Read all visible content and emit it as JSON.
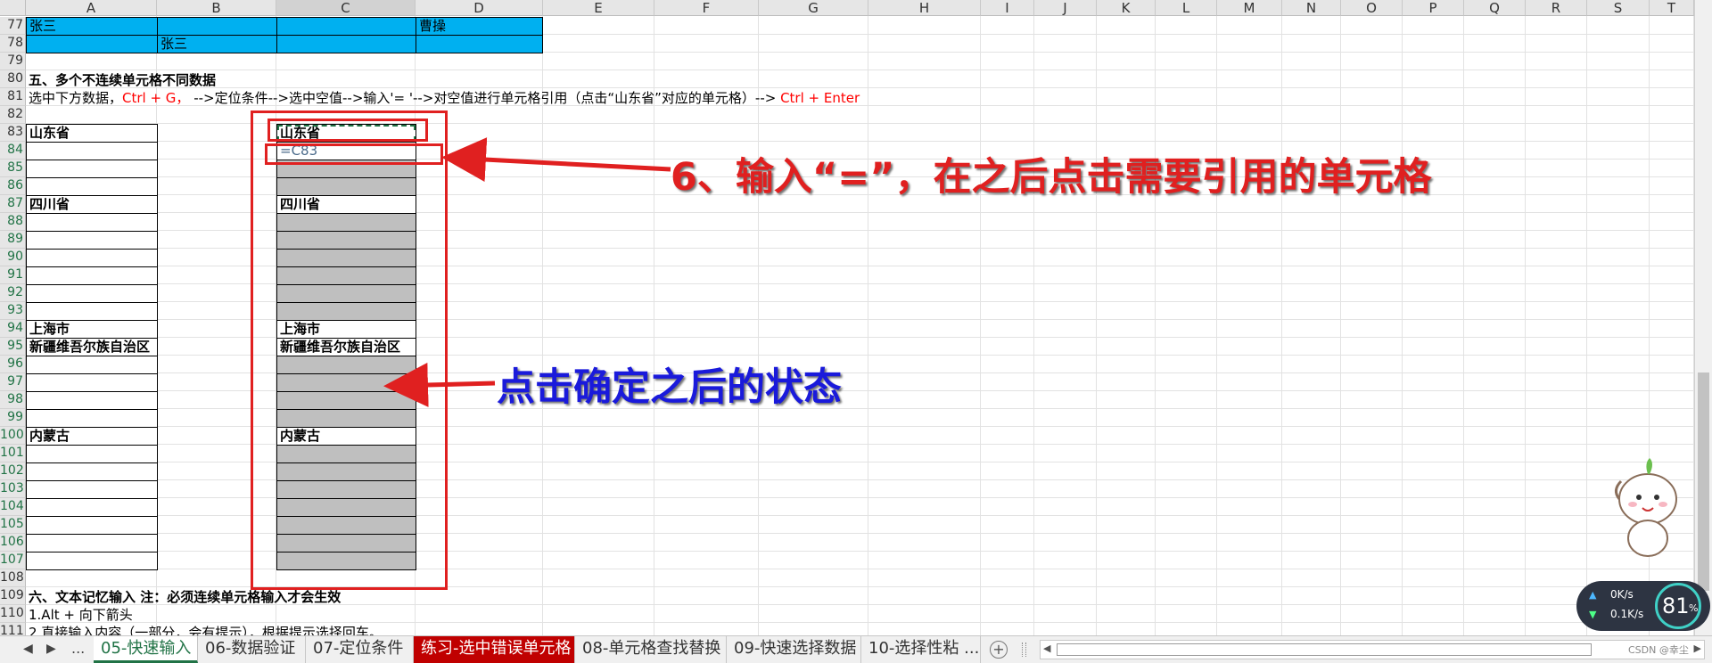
{
  "columns": [
    "A",
    "B",
    "C",
    "D",
    "E",
    "F",
    "G",
    "H",
    "I",
    "J",
    "K",
    "L",
    "M",
    "N",
    "O",
    "P",
    "Q",
    "R",
    "S",
    "T"
  ],
  "selected_column": "C",
  "rows": [
    "77",
    "78",
    "79",
    "80",
    "81",
    "82",
    "83",
    "84",
    "85",
    "86",
    "87",
    "88",
    "89",
    "90",
    "91",
    "92",
    "93",
    "94",
    "95",
    "96",
    "97",
    "98",
    "99",
    "100",
    "101",
    "102",
    "103",
    "104",
    "105",
    "106",
    "107",
    "108",
    "109",
    "110",
    "111"
  ],
  "cells": {
    "a77": "张三",
    "d77": "曹操",
    "b78": "张三",
    "section5_title": "五、多个不连续单元格不同数据",
    "instr_1": "选中下方数据，",
    "instr_ctrlg": "Ctrl + G，",
    "instr_2": " -->定位条件-->选中空值-->输入'= '-->对空值进行单元格引用（点击“山东省”对应的单元格）-->",
    "instr_ctrlenter": " Ctrl + Enter",
    "a83": "山东省",
    "c83": "山东省",
    "c84": "=C83",
    "a87": "四川省",
    "c87": "四川省",
    "a94": "上海市",
    "c94": "上海市",
    "a95": "新疆维吾尔族自治区",
    "c95": "新疆维吾尔族自治区",
    "a100": "内蒙古",
    "c100": "内蒙古",
    "section6_title": "六、文本记忆输入    注：必须连续单元格输入才会生效",
    "row110": "1.Alt + 向下箭头",
    "row111": "2.直接输入内容（一部分，会有提示），根据提示选择回车。"
  },
  "annotations": {
    "step6": "6、输入“=”，在之后点击需要引用的单元格",
    "after_ok": "点击确定之后的状态"
  },
  "tabs": [
    {
      "label": "05-快速输入",
      "state": "active"
    },
    {
      "label": "06-数据验证",
      "state": "normal"
    },
    {
      "label": "07-定位条件",
      "state": "normal"
    },
    {
      "label": "练习-选中错误单元格",
      "state": "red"
    },
    {
      "label": "08-单元格查找替换",
      "state": "normal"
    },
    {
      "label": "09-快速选择数据",
      "state": "normal"
    },
    {
      "label": "10-选择性粘 ...",
      "state": "normal"
    }
  ],
  "tab_nav": {
    "prev": "◀",
    "next": "▶",
    "more": "...",
    "add": "+"
  },
  "net_widget": {
    "up": "0K/s",
    "down": "0.1K/s",
    "percent": "81",
    "percent_sign": "%"
  },
  "watermark": "CSDN @幸尘",
  "colors": {
    "header_blue": "#00b0f0",
    "fill_gray": "#bfbfbf",
    "red": "#ff0000",
    "annotation_blue": "#1a1adb",
    "excel_green": "#217346"
  }
}
